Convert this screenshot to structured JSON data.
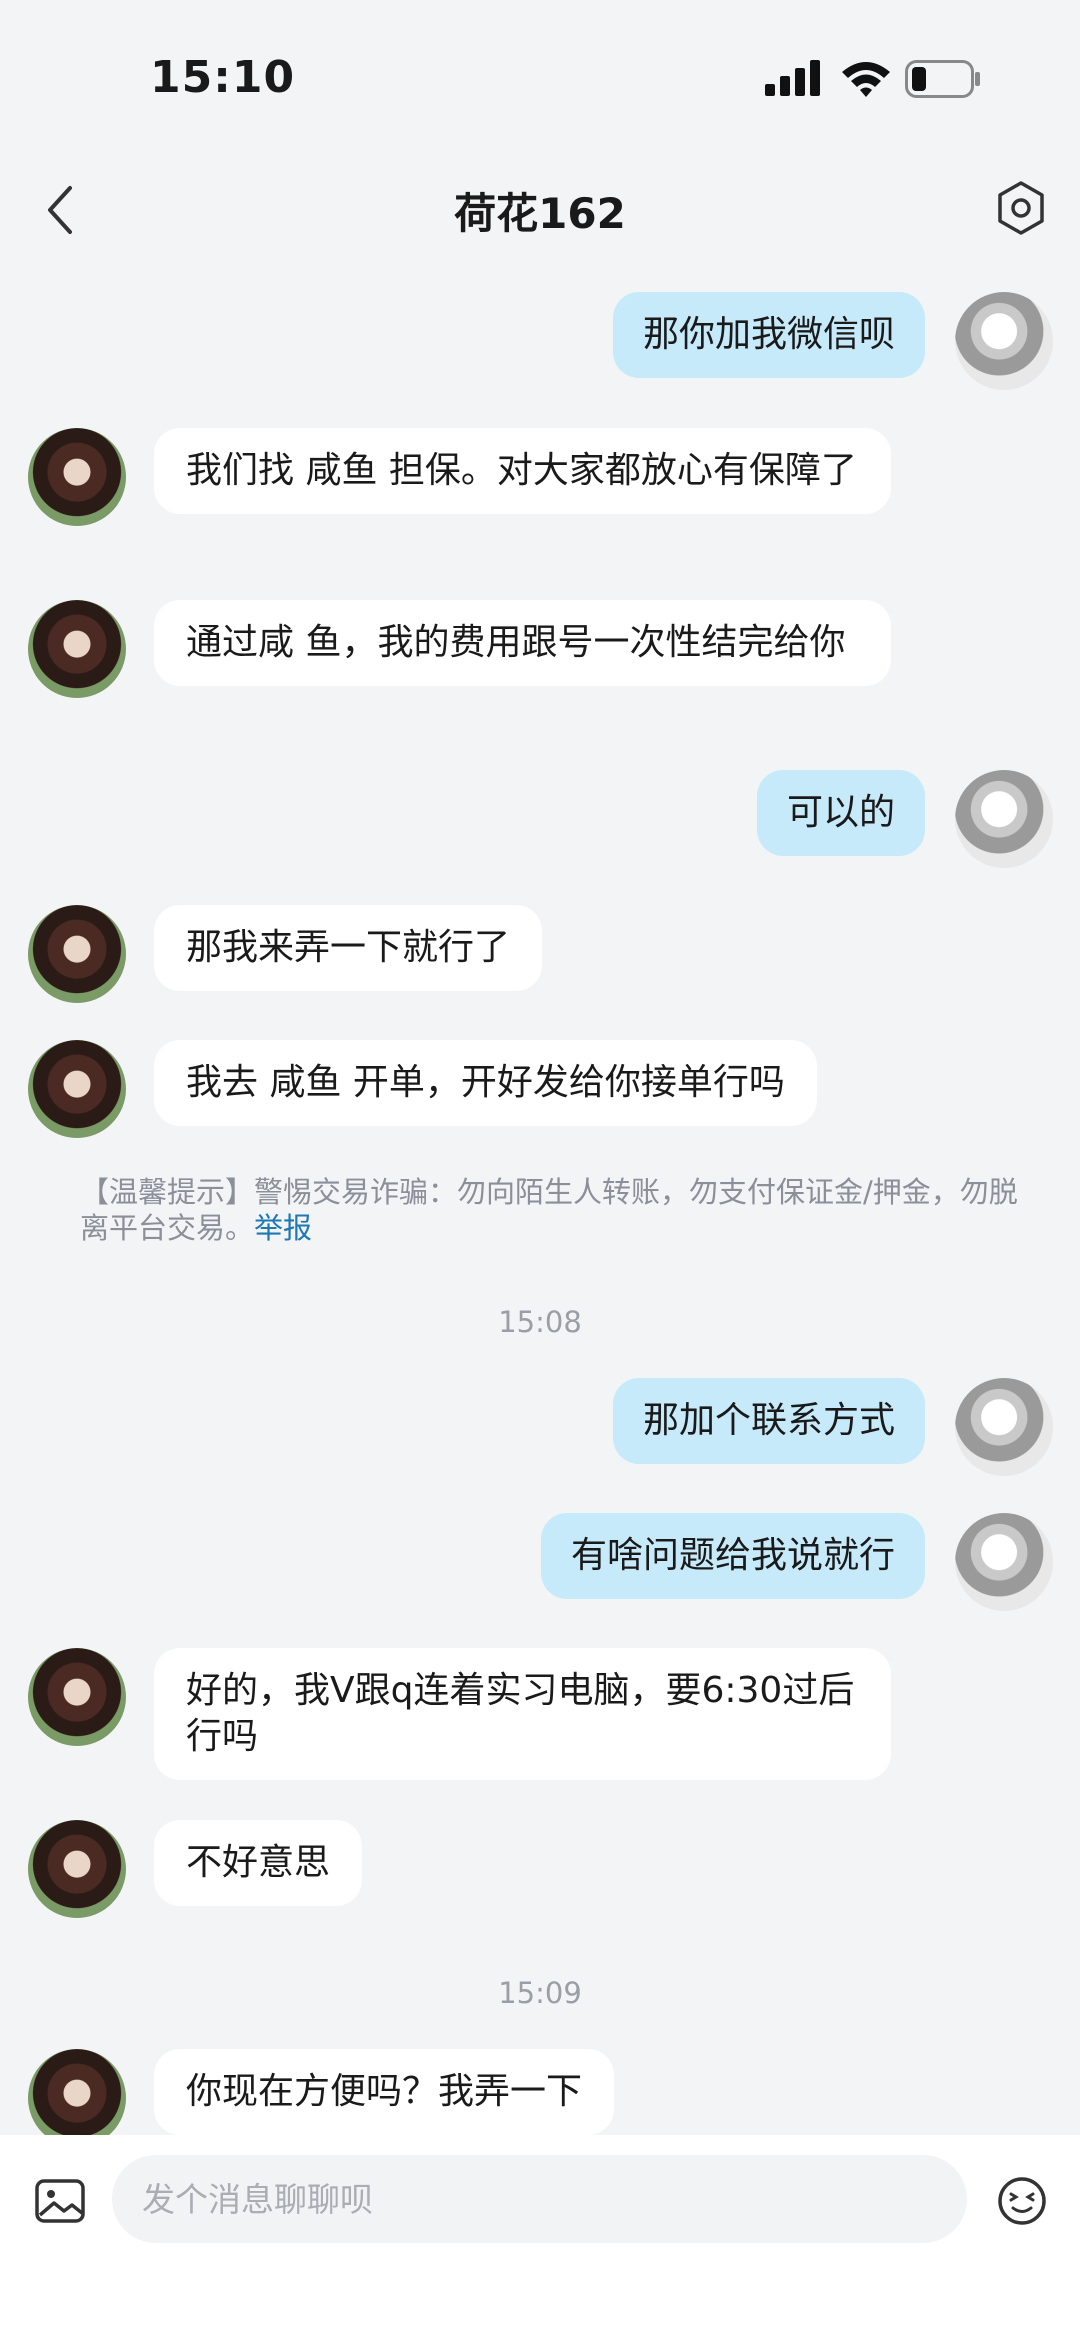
{
  "status_bar": {
    "time": "15:10"
  },
  "header": {
    "title": "荷花162"
  },
  "messages": [
    {
      "side": "right",
      "text": "那你加我微信呗"
    },
    {
      "side": "left",
      "text": "我们找 咸鱼 担保。对大家都放心有保障了"
    },
    {
      "side": "left",
      "text": "通过咸 鱼，我的费用跟号一次性结完给你"
    },
    {
      "side": "right",
      "text": "可以的"
    },
    {
      "side": "left",
      "text": "那我来弄一下就行了"
    },
    {
      "side": "left",
      "text": "我去 咸鱼 开单，开好发给你接单行吗"
    },
    {
      "side": "right",
      "text": "那加个联系方式"
    },
    {
      "side": "right",
      "text": "有啥问题给我说就行"
    },
    {
      "side": "left",
      "text": "好的，我V跟q连着实习电脑，要6:30过后行吗"
    },
    {
      "side": "left",
      "text": "不好意思"
    },
    {
      "side": "left",
      "text": "你现在方便吗？我弄一下"
    }
  ],
  "notice": {
    "text": "【温馨提示】警惕交易诈骗：勿向陌生人转账，勿支付保证金/押金，勿脱离平台交易。",
    "link": "举报"
  },
  "timestamps": [
    "15:08",
    "15:09"
  ],
  "input": {
    "placeholder": "发个消息聊聊呗"
  },
  "colors": {
    "background": "#f3f4f6",
    "sent_bubble": "#c6eafa",
    "received_bubble": "#ffffff",
    "link": "#1e78b4"
  },
  "icons": [
    "signal-icon",
    "wifi-icon",
    "battery-icon",
    "back-arrow-icon",
    "settings-icon",
    "image-icon",
    "emoji-icon"
  ]
}
